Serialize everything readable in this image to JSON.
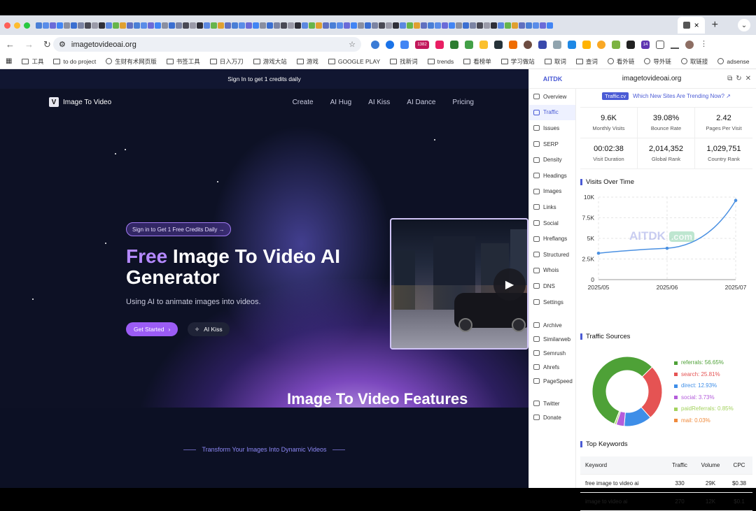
{
  "browser": {
    "active_tab_close": "×",
    "new_tab": "+",
    "url": "imagetovideoai.org",
    "ext_badge": "14",
    "ext_count": "1382",
    "bookmarks": [
      "工具",
      "to do project",
      "生财有术网页版",
      "书签工具",
      "日入万刀",
      "游戏大站",
      "游戏",
      "GOOGLE PLAY",
      "找新词",
      "trends",
      "看榜单",
      "学习做站",
      "取词",
      "查词",
      "看外链",
      "导外链",
      "取链接",
      "adsense"
    ]
  },
  "site": {
    "banner": "Sign In to get 1 credits daily",
    "logo_letter": "V",
    "logo_text": "Image To Video",
    "nav": [
      "Create",
      "AI Hug",
      "AI Kiss",
      "AI Dance",
      "Pricing"
    ],
    "pill": "Sign in to Get 1 Free Credits Daily →",
    "headline_free": "Free",
    "headline_rest": " Image To Video AI Generator",
    "subtitle": "Using AI to animate images into videos.",
    "cta_primary": "Get Started",
    "cta_secondary": "AI Kiss",
    "tagline": "Transform Your Images Into Dynamic Videos",
    "section_title": "Image To Video Features"
  },
  "panel": {
    "brand": "AITDK",
    "domain": "imagetovideoai.org",
    "trend_tag": "Traffic.cv",
    "trend_text": "Which New Sites Are Trending Now? ↗",
    "sidebar": [
      "Overview",
      "Traffic",
      "Issues",
      "SERP",
      "Density",
      "Headings",
      "Images",
      "Links",
      "Social",
      "Hreflangs",
      "Structured",
      "Whois",
      "DNS",
      "Settings"
    ],
    "sidebar_tools": [
      "Archive",
      "Similarweb",
      "Semrush",
      "Ahrefs",
      "PageSpeed"
    ],
    "sidebar_social": [
      "Twitter",
      "Donate"
    ],
    "stats": [
      {
        "value": "9.6K",
        "label": "Monthly Visits"
      },
      {
        "value": "39.08%",
        "label": "Bounce Rate"
      },
      {
        "value": "2.42",
        "label": "Pages Per Visit"
      },
      {
        "value": "00:02:38",
        "label": "Visit Duration"
      },
      {
        "value": "2,014,352",
        "label": "Global Rank"
      },
      {
        "value": "1,029,751",
        "label": "Country Rank"
      }
    ],
    "visits_title": "Visits Over Time",
    "watermark": "AITDK",
    "watermark_tld": ".com",
    "sources_title": "Traffic Sources",
    "keywords_title": "Top Keywords",
    "kw_headers": [
      "Keyword",
      "Traffic",
      "Volume",
      "CPC"
    ],
    "kw_rows": [
      [
        "free image to video ai",
        "330",
        "29K",
        "$0.38"
      ],
      [
        "image to video ai",
        "270",
        "12K",
        "$0.1"
      ]
    ]
  },
  "chart_data": [
    {
      "type": "line",
      "title": "Visits Over Time",
      "x": [
        "2025/05",
        "2025/06",
        "2025/07"
      ],
      "series": [
        {
          "values": [
            3200,
            3800,
            9600
          ]
        }
      ],
      "yticks": [
        "0",
        "2.5K",
        "5K",
        "7.5K",
        "10K"
      ],
      "ylim": [
        0,
        10000
      ],
      "grid": true,
      "color": "#4a90e2"
    },
    {
      "type": "pie",
      "title": "Traffic Sources",
      "categories": [
        "referrals",
        "search",
        "direct",
        "social",
        "paidReferrals",
        "mail"
      ],
      "values": [
        56.65,
        25.81,
        12.93,
        3.73,
        0.85,
        0.03
      ],
      "labels": [
        "referrals: 56.65%",
        "search: 25.81%",
        "direct: 12.93%",
        "social: 3.73%",
        "paidReferrals: 0.85%",
        "mail: 0.03%"
      ],
      "colors": [
        "#4ea137",
        "#e55353",
        "#3e8ee8",
        "#b45ddb",
        "#a3d25e",
        "#f08a3c"
      ],
      "legend": "right"
    }
  ]
}
